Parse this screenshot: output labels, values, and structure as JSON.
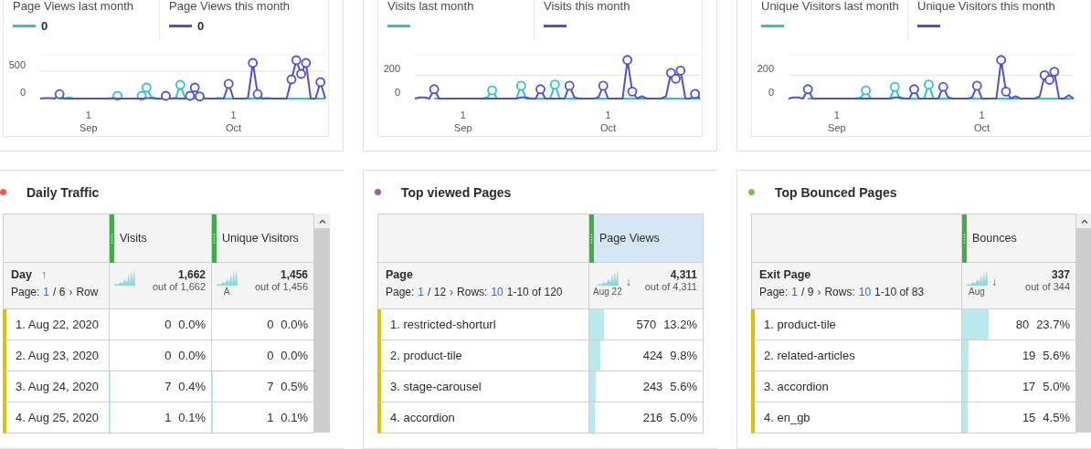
{
  "trend_cards": [
    {
      "legend_values": [
        "0",
        "0"
      ],
      "chart_data": {
        "type": "line",
        "categories": [
          null,
          null,
          null,
          null,
          null,
          null,
          null,
          null,
          null,
          null,
          "1 Sep",
          null,
          null,
          null,
          null,
          null,
          null,
          null,
          null,
          null,
          null,
          null,
          null,
          null,
          null,
          null,
          null,
          null,
          null,
          null,
          null,
          null,
          null,
          null,
          null,
          null,
          null,
          null,
          null,
          null,
          "1 Oct",
          null,
          null,
          null,
          null,
          null,
          null,
          null,
          null,
          null,
          null,
          null,
          null,
          null,
          null,
          null,
          null,
          null,
          null,
          null
        ],
        "ylim": [
          0,
          800
        ],
        "yticks": [
          0,
          500
        ],
        "series": [
          {
            "name": "Page Views last month",
            "color": "#2ec4c6",
            "values": [
              null,
              null,
              null,
              null,
              0,
              0,
              20,
              0,
              0,
              0,
              0,
              0,
              0,
              0,
              0,
              0,
              50,
              0,
              0,
              0,
              0,
              50,
              200,
              30,
              0,
              0,
              0,
              0,
              0,
              250,
              0,
              0,
              0,
              0,
              0,
              0,
              0,
              0,
              0,
              0,
              0,
              0,
              0,
              0,
              0,
              0,
              0,
              0,
              0,
              0,
              0,
              0,
              0,
              0,
              0,
              0,
              0,
              0,
              0,
              0
            ]
          },
          {
            "name": "Page Views this month",
            "color": "#5050d4",
            "values": [
              0,
              10,
              10,
              0,
              80,
              0,
              0,
              0,
              0,
              0,
              0,
              0,
              0,
              0,
              0,
              10,
              0,
              0,
              0,
              0,
              0,
              0,
              10,
              10,
              0,
              0,
              50,
              0,
              10,
              0,
              0,
              50,
              200,
              40,
              10,
              0,
              0,
              10,
              0,
              270,
              0,
              0,
              0,
              10,
              650,
              80,
              0,
              10,
              0,
              0,
              0,
              0,
              350,
              700,
              450,
              650,
              0,
              0,
              300,
              0
            ]
          }
        ]
      }
    },
    {
      "chart_data": {
        "type": "line",
        "categories": [
          null,
          null,
          null,
          null,
          null,
          null,
          null,
          null,
          null,
          null,
          "1 Sep",
          null,
          null,
          null,
          null,
          null,
          null,
          null,
          null,
          null,
          null,
          null,
          null,
          null,
          null,
          null,
          null,
          null,
          null,
          null,
          null,
          null,
          null,
          null,
          null,
          null,
          null,
          null,
          null,
          null,
          "1 Oct",
          null,
          null,
          null,
          null,
          null,
          null,
          null,
          null,
          null,
          null,
          null,
          null,
          null,
          null,
          null,
          null,
          null,
          null,
          null
        ],
        "ylim": [
          0,
          375
        ],
        "yticks": [
          0,
          200
        ],
        "series": [
          {
            "name": "Visits last month",
            "color": "#2ec4c6",
            "values": [
              null,
              null,
              null,
              null,
              0,
              0,
              0,
              0,
              0,
              0,
              0,
              0,
              0,
              0,
              0,
              10,
              70,
              0,
              0,
              0,
              0,
              0,
              110,
              0,
              0,
              0,
              0,
              0,
              0,
              120,
              0,
              0,
              0,
              0,
              0,
              0,
              0,
              0,
              0,
              0,
              0,
              0,
              0,
              0,
              0,
              0,
              0,
              0,
              0,
              0,
              0,
              0,
              0,
              0,
              0,
              0,
              0,
              0,
              0,
              0
            ]
          },
          {
            "name": "Visits this month",
            "color": "#5050d4",
            "values": [
              0,
              10,
              10,
              0,
              80,
              0,
              0,
              0,
              0,
              0,
              0,
              0,
              0,
              0,
              0,
              0,
              0,
              0,
              0,
              0,
              0,
              0,
              10,
              10,
              0,
              0,
              80,
              0,
              0,
              0,
              0,
              0,
              110,
              10,
              0,
              0,
              0,
              0,
              10,
              110,
              0,
              0,
              0,
              0,
              330,
              60,
              0,
              20,
              0,
              0,
              0,
              0,
              20,
              220,
              170,
              240,
              0,
              0,
              40,
              0
            ]
          }
        ]
      }
    },
    {
      "chart_data": {
        "type": "line",
        "categories": [
          null,
          null,
          null,
          null,
          null,
          null,
          null,
          null,
          null,
          null,
          "1 Sep",
          null,
          null,
          null,
          null,
          null,
          null,
          null,
          null,
          null,
          null,
          null,
          null,
          null,
          null,
          null,
          null,
          null,
          null,
          null,
          null,
          null,
          null,
          null,
          null,
          null,
          null,
          null,
          null,
          null,
          "1 Oct",
          null,
          null,
          null,
          null,
          null,
          null,
          null,
          null,
          null,
          null,
          null,
          null,
          null,
          null,
          null,
          null,
          null,
          null,
          null
        ],
        "ylim": [
          0,
          375
        ],
        "yticks": [
          0,
          200
        ],
        "series": [
          {
            "name": "Unique Visitors last month",
            "color": "#2ec4c6",
            "values": [
              null,
              null,
              null,
              null,
              0,
              0,
              0,
              0,
              0,
              0,
              0,
              0,
              0,
              0,
              0,
              10,
              70,
              0,
              0,
              0,
              0,
              0,
              100,
              0,
              0,
              0,
              0,
              0,
              0,
              120,
              0,
              0,
              0,
              0,
              0,
              0,
              0,
              0,
              0,
              0,
              0,
              0,
              0,
              0,
              0,
              0,
              0,
              0,
              0,
              0,
              0,
              0,
              0,
              0,
              0,
              0,
              0,
              0,
              0,
              0
            ]
          },
          {
            "name": "Unique Visitors this month",
            "color": "#5050d4",
            "values": [
              0,
              10,
              10,
              0,
              80,
              0,
              0,
              0,
              0,
              0,
              0,
              0,
              0,
              0,
              0,
              0,
              0,
              0,
              0,
              0,
              0,
              0,
              10,
              10,
              0,
              0,
              80,
              0,
              0,
              0,
              0,
              0,
              100,
              10,
              0,
              0,
              0,
              0,
              10,
              110,
              0,
              0,
              0,
              0,
              330,
              60,
              0,
              20,
              0,
              0,
              0,
              0,
              20,
              200,
              160,
              230,
              0,
              0,
              30,
              0
            ]
          }
        ]
      }
    }
  ],
  "panels": [
    {
      "title": "Daily Traffic",
      "color": "#f05a4f",
      "scrollable": true,
      "table": {
        "dimension": {
          "name": "Day",
          "sort_arrow": "↑",
          "pager": [
            {
              "kind": "text",
              "text": "Page:"
            },
            {
              "kind": "link",
              "text": "1"
            },
            {
              "kind": "text",
              "text": "/ 6"
            },
            {
              "kind": "chevron",
              "text": "›"
            },
            {
              "kind": "text",
              "text": "Row"
            }
          ]
        },
        "metrics": [
          {
            "name": "Visits",
            "selected": false,
            "total": "1,662",
            "out_of": "out of 1,662"
          },
          {
            "name": "Unique Visitors",
            "selected": false,
            "trend_label": "A",
            "total": "1,456",
            "out_of": "out of 1,456"
          }
        ],
        "rows": [
          {
            "label": "1. Aug 22, 2020",
            "cells": [
              {
                "value": "0",
                "percent": "0.0%"
              },
              {
                "value": "0",
                "percent": "0.0%"
              }
            ]
          },
          {
            "label": "2. Aug 23, 2020",
            "cells": [
              {
                "value": "0",
                "percent": "0.0%"
              },
              {
                "value": "0",
                "percent": "0.0%"
              }
            ]
          },
          {
            "label": "3. Aug 24, 2020",
            "cells": [
              {
                "value": "7",
                "percent": "0.4%",
                "level": 0.004
              },
              {
                "value": "7",
                "percent": "0.5%",
                "level": 0.005
              }
            ]
          },
          {
            "label": "4. Aug 25, 2020",
            "cells": [
              {
                "value": "1",
                "percent": "0.1%",
                "level": 0.001
              },
              {
                "value": "1",
                "percent": "0.1%",
                "level": 0.001
              }
            ]
          }
        ]
      }
    },
    {
      "title": "Top viewed Pages",
      "color": "#a05aa6",
      "scrollable": false,
      "table": {
        "dimension": {
          "name": "Page",
          "pager": [
            {
              "kind": "text",
              "text": "Page:"
            },
            {
              "kind": "link",
              "text": "1"
            },
            {
              "kind": "text",
              "text": "/ 12"
            },
            {
              "kind": "chevron",
              "text": "›"
            },
            {
              "kind": "text",
              "text": "Rows:"
            },
            {
              "kind": "link",
              "text": "10"
            },
            {
              "kind": "text",
              "text": "1-10 of 120"
            }
          ]
        },
        "metrics": [
          {
            "name": "Page Views",
            "selected": true,
            "trend_label": "Aug 22",
            "sort_arrow": "↓",
            "total": "4,311",
            "out_of": "out of 4,311"
          }
        ],
        "rows": [
          {
            "label": "1. restricted-shorturl",
            "cells": [
              {
                "value": "570",
                "percent": "13.2%",
                "level": 0.132
              }
            ]
          },
          {
            "label": "2. product-tile",
            "cells": [
              {
                "value": "424",
                "percent": "9.8%",
                "level": 0.098
              }
            ]
          },
          {
            "label": "3. stage-carousel",
            "cells": [
              {
                "value": "243",
                "percent": "5.6%",
                "level": 0.056
              }
            ]
          },
          {
            "label": "4. accordion",
            "cells": [
              {
                "value": "216",
                "percent": "5.0%",
                "level": 0.05
              }
            ]
          }
        ]
      }
    },
    {
      "title": "Top Bounced Pages",
      "color": "#7fc24a",
      "scrollable": true,
      "table": {
        "dimension": {
          "name": "Exit Page",
          "pager": [
            {
              "kind": "text",
              "text": "Page:"
            },
            {
              "kind": "link",
              "text": "1"
            },
            {
              "kind": "text",
              "text": "/ 9"
            },
            {
              "kind": "chevron",
              "text": "›"
            },
            {
              "kind": "text",
              "text": "Rows:"
            },
            {
              "kind": "link",
              "text": "10"
            },
            {
              "kind": "text",
              "text": "1-10 of 83"
            }
          ]
        },
        "metrics": [
          {
            "name": "Bounces",
            "selected": false,
            "trend_label": "Aug",
            "sort_arrow": "↓",
            "total": "337",
            "out_of": "out of 344"
          }
        ],
        "rows": [
          {
            "label": "1. product-tile",
            "cells": [
              {
                "value": "80",
                "percent": "23.7%",
                "level": 0.237
              }
            ]
          },
          {
            "label": "2. related-articles",
            "cells": [
              {
                "value": "19",
                "percent": "5.6%",
                "level": 0.056
              }
            ]
          },
          {
            "label": "3. accordion",
            "cells": [
              {
                "value": "17",
                "percent": "5.0%",
                "level": 0.05
              }
            ]
          },
          {
            "label": "4. en_gb",
            "cells": [
              {
                "value": "15",
                "percent": "4.5%",
                "level": 0.045
              }
            ]
          }
        ]
      }
    }
  ]
}
